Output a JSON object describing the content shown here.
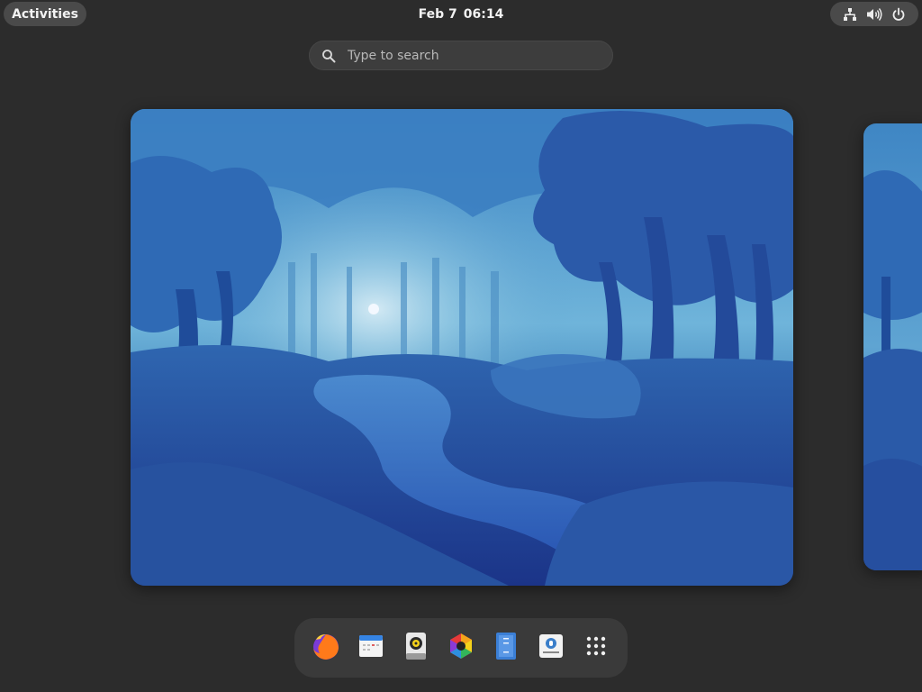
{
  "topbar": {
    "activities_label": "Activities",
    "date": "Feb 7",
    "time": "06:14",
    "system_icons": [
      "network-wired-icon",
      "volume-icon",
      "power-icon"
    ]
  },
  "search": {
    "placeholder": "Type to search",
    "value": ""
  },
  "workspaces": [
    {
      "name": "workspace-1",
      "active": true,
      "wallpaper": "blue forest painting"
    },
    {
      "name": "workspace-2",
      "active": false,
      "wallpaper": "blue forest painting"
    }
  ],
  "dock": {
    "items": [
      {
        "name": "firefox",
        "icon": "firefox-icon"
      },
      {
        "name": "calendar",
        "icon": "calendar-icon"
      },
      {
        "name": "rhythmbox",
        "icon": "speaker-icon"
      },
      {
        "name": "photos",
        "icon": "color-wheel-icon"
      },
      {
        "name": "text-editor",
        "icon": "text-editor-icon"
      },
      {
        "name": "software",
        "icon": "software-icon"
      },
      {
        "name": "show-apps",
        "icon": "app-grid-icon"
      }
    ]
  },
  "colors": {
    "background": "#2c2c2c",
    "pill": "#4a4a4a",
    "dock": "#3a3a3a",
    "accent_blue": "#3584e4"
  }
}
